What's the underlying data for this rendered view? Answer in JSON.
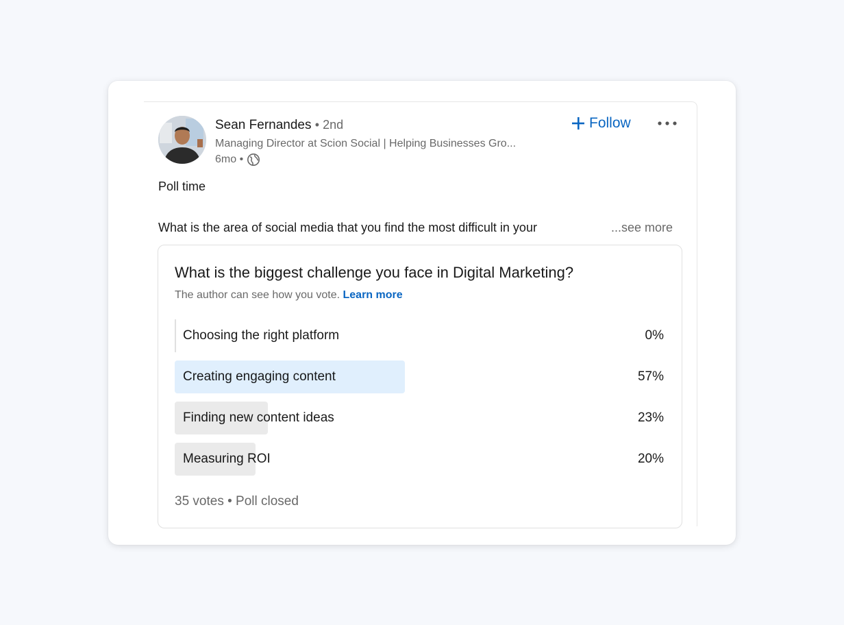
{
  "post": {
    "author": {
      "name": "Sean Fernandes",
      "connection": "• 2nd",
      "headline": "Managing Director at Scion Social | Helping Businesses Gro...",
      "time": "6mo •",
      "visibility_icon": "globe-icon",
      "avatar_icon": "avatar-photo"
    },
    "follow_label": "Follow",
    "follow_icon": "plus-icon",
    "more_icon": "ellipsis-icon",
    "text_line1": "Poll time",
    "text_line2": "What is the area of social media that you find the most difficult in your",
    "see_more": "...see more"
  },
  "poll": {
    "question": "What is the biggest challenge you face in Digital Marketing?",
    "note": "The author can see how you vote.",
    "learn_more": "Learn more",
    "options": [
      {
        "label": "Choosing the right platform",
        "percent_label": "0%",
        "percent": 0,
        "leading": false
      },
      {
        "label": "Creating engaging content",
        "percent_label": "57%",
        "percent": 57,
        "leading": true
      },
      {
        "label": "Finding new content ideas",
        "percent_label": "23%",
        "percent": 23,
        "leading": false
      },
      {
        "label": "Measuring ROI",
        "percent_label": "20%",
        "percent": 20,
        "leading": false
      }
    ],
    "footer": "35 votes • Poll closed"
  },
  "colors": {
    "accent": "#0a66c2",
    "leading_fill": "#e0effd",
    "other_fill": "#eaeaea",
    "page_bg": "#f6f8fc"
  }
}
